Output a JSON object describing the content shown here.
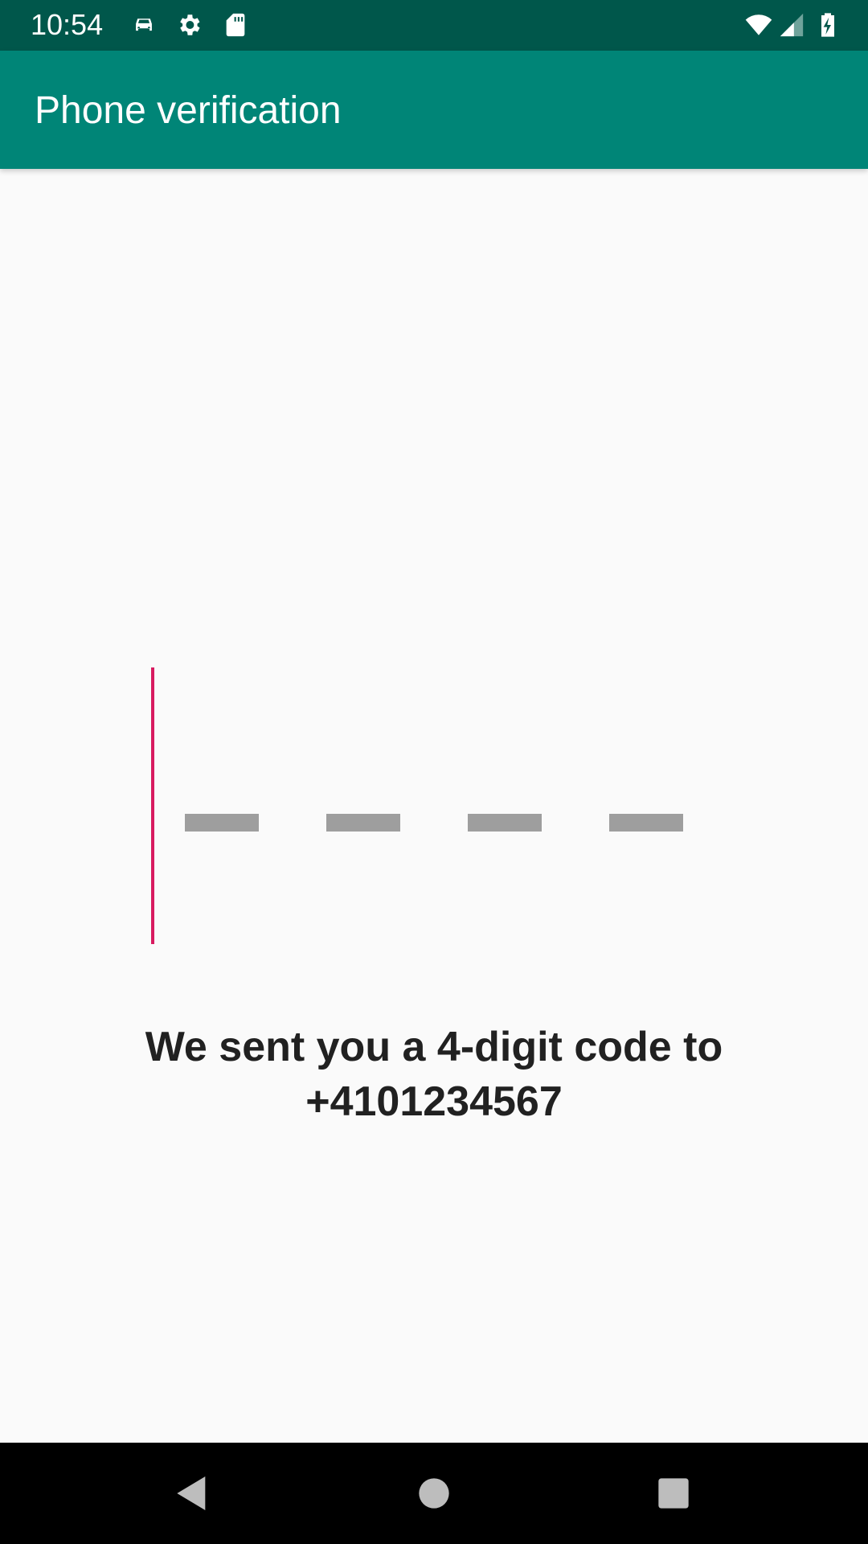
{
  "status_bar": {
    "time": "10:54",
    "left_icons": [
      "car-icon",
      "gear-icon",
      "sd-card-icon"
    ],
    "right_icons": [
      "wifi-icon",
      "signal-icon",
      "battery-charging-icon"
    ]
  },
  "app_bar": {
    "title": "Phone verification",
    "color": "#008577",
    "status_color": "#00574b"
  },
  "code_input": {
    "digits": 4,
    "value": "",
    "cursor_color": "#d81b60",
    "slot_color": "#9e9e9e"
  },
  "message": {
    "line1": "We sent you a 4-digit code to",
    "line2": "+4101234567"
  },
  "nav_bar": {
    "buttons": [
      "back-icon",
      "home-icon",
      "recents-icon"
    ]
  }
}
